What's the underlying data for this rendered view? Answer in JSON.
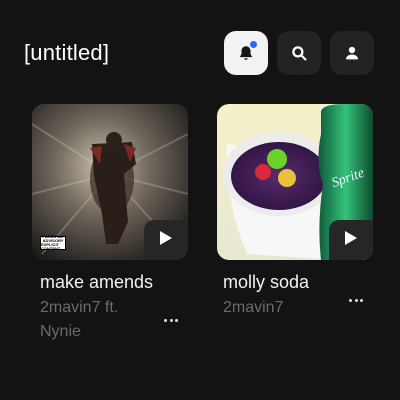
{
  "header": {
    "title": "[untitled]"
  },
  "tracks": [
    {
      "title": "make amends",
      "artist": "2mavin7 ft. Nynie"
    },
    {
      "title": "molly soda",
      "artist": "2mavin7"
    }
  ],
  "advisory": {
    "line1": "PARENTAL",
    "line2": "ADVISORY",
    "line3": "EXPLICIT CONTENT"
  },
  "bottle_label": "Sprite"
}
